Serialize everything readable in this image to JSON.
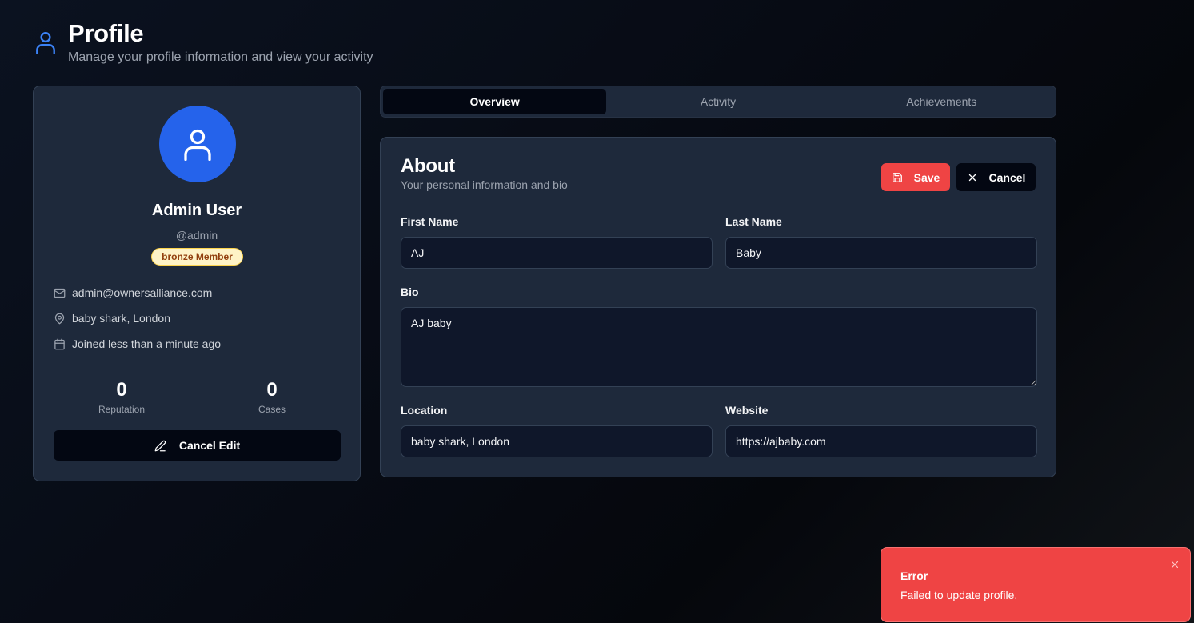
{
  "header": {
    "title": "Profile",
    "subtitle": "Manage your profile information and view your activity",
    "icon": "user-icon"
  },
  "profile": {
    "name": "Admin User",
    "handle": "@admin",
    "badge": "bronze Member",
    "email": "admin@ownersalliance.com",
    "location": "baby shark, London",
    "joined": "Joined less than a minute ago",
    "stats": [
      {
        "value": "0",
        "label": "Reputation"
      },
      {
        "value": "0",
        "label": "Cases"
      }
    ],
    "cancel_edit_label": "Cancel Edit"
  },
  "tabs": [
    {
      "label": "Overview",
      "active": true
    },
    {
      "label": "Activity",
      "active": false
    },
    {
      "label": "Achievements",
      "active": false
    }
  ],
  "about": {
    "title": "About",
    "subtitle": "Your personal information and bio",
    "save_label": "Save",
    "cancel_label": "Cancel",
    "fields": {
      "first_name": {
        "label": "First Name",
        "value": "AJ"
      },
      "last_name": {
        "label": "Last Name",
        "value": "Baby"
      },
      "bio": {
        "label": "Bio",
        "value": "AJ baby"
      },
      "location": {
        "label": "Location",
        "value": "baby shark, London"
      },
      "website": {
        "label": "Website",
        "value": "https://ajbaby.com"
      }
    }
  },
  "toast": {
    "title": "Error",
    "message": "Failed to update profile."
  },
  "colors": {
    "accent": "#2563eb",
    "danger": "#ef4444",
    "card": "#1e293b",
    "badge_bg": "#fef3c7",
    "badge_text": "#92400e"
  }
}
